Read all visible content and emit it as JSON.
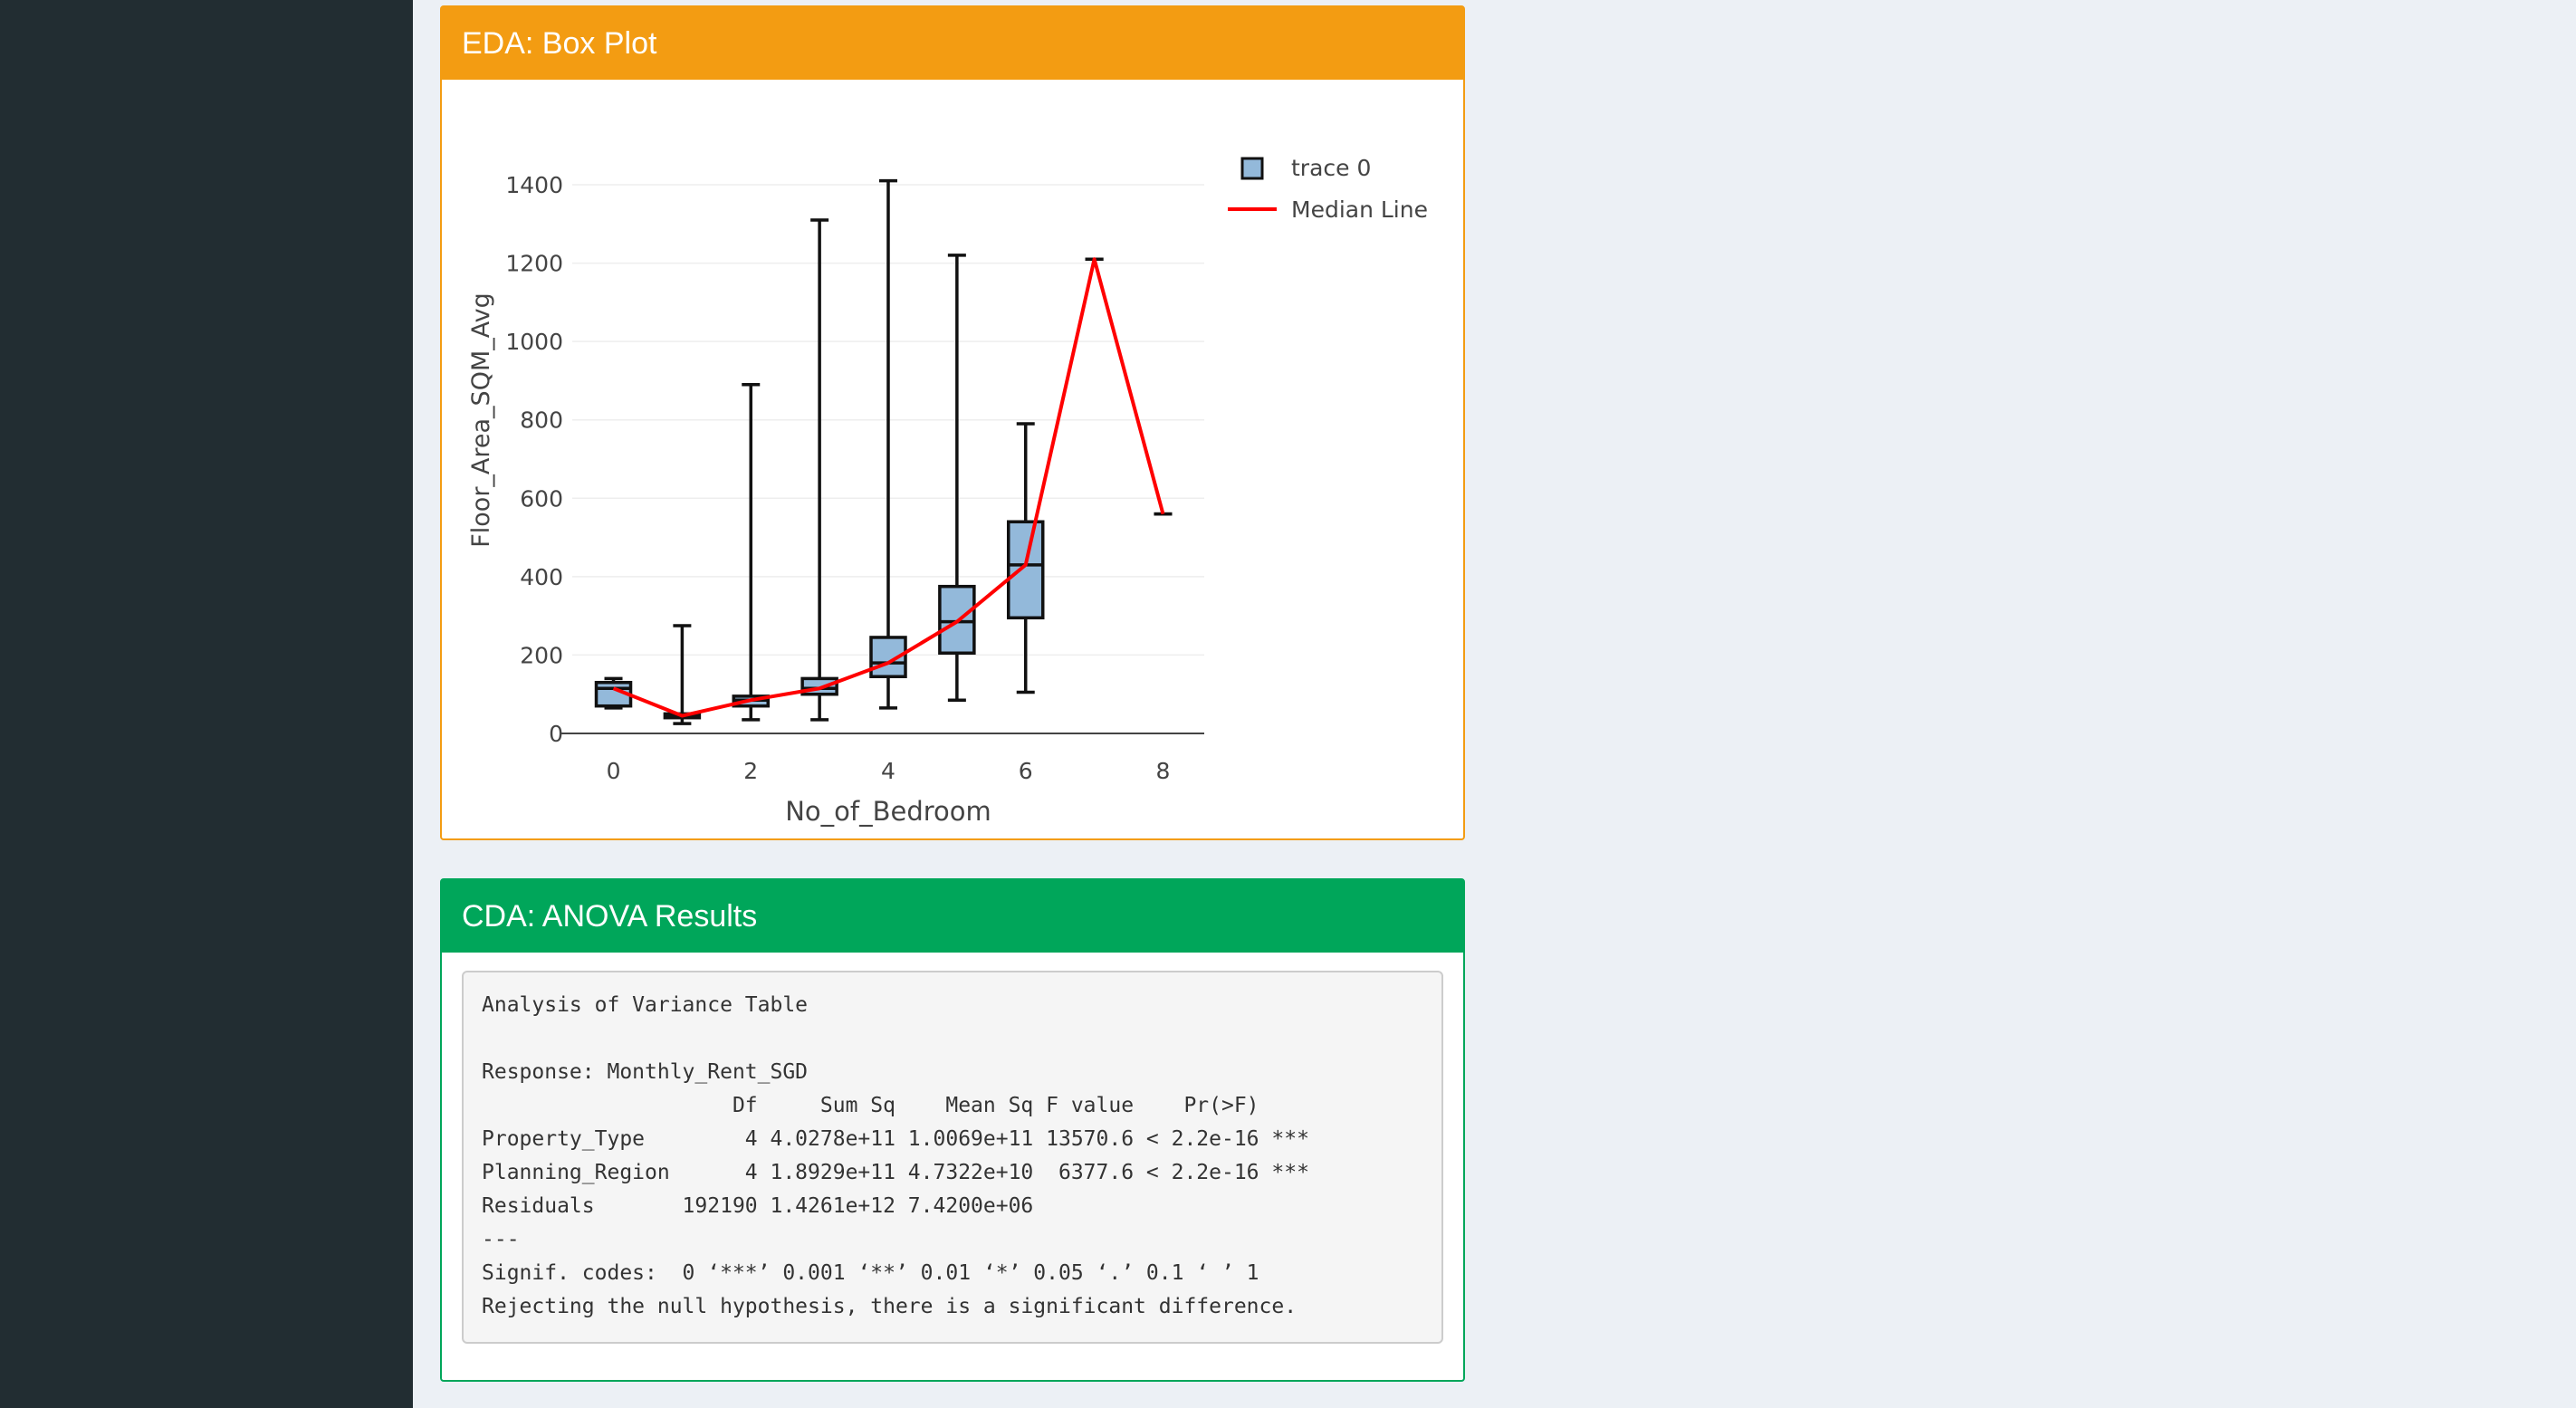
{
  "eda_box": {
    "title": "EDA: Box Plot"
  },
  "cda_box": {
    "title": "CDA: ANOVA Results"
  },
  "chart_data": {
    "type": "box",
    "xlabel": "No_of_Bedroom",
    "ylabel": "Floor_Area_SQM_Avg",
    "xlim": [
      -0.6,
      8.6
    ],
    "ylim": [
      0,
      1400
    ],
    "x_ticks": [
      0,
      2,
      4,
      6,
      8
    ],
    "y_ticks": [
      0,
      200,
      400,
      600,
      800,
      1000,
      1200,
      1400
    ],
    "grid": true,
    "legend_position": "top-right",
    "box_fill": "#93b9da",
    "box_stroke": "#111111",
    "line_color": "#ff0000",
    "series": [
      {
        "name": "trace 0",
        "kind": "box",
        "boxes": [
          {
            "x": 0,
            "min": 65,
            "q1": 70,
            "median": 115,
            "q3": 130,
            "max": 140
          },
          {
            "x": 1,
            "min": 25,
            "q1": 40,
            "median": 45,
            "q3": 50,
            "max": 275
          },
          {
            "x": 2,
            "min": 35,
            "q1": 70,
            "median": 85,
            "q3": 95,
            "max": 890
          },
          {
            "x": 3,
            "min": 35,
            "q1": 100,
            "median": 115,
            "q3": 140,
            "max": 1310
          },
          {
            "x": 4,
            "min": 65,
            "q1": 145,
            "median": 180,
            "q3": 245,
            "max": 1410
          },
          {
            "x": 5,
            "min": 85,
            "q1": 205,
            "median": 285,
            "q3": 375,
            "max": 1220
          },
          {
            "x": 6,
            "min": 105,
            "q1": 295,
            "median": 430,
            "q3": 540,
            "max": 790
          },
          {
            "x": 7,
            "min": 1210,
            "q1": 1210,
            "median": 1210,
            "q3": 1210,
            "max": 1210
          },
          {
            "x": 8,
            "min": 560,
            "q1": 560,
            "median": 560,
            "q3": 560,
            "max": 560
          }
        ]
      },
      {
        "name": "Median Line",
        "kind": "line",
        "x": [
          0,
          1,
          2,
          3,
          4,
          5,
          6,
          7,
          8
        ],
        "values": [
          115,
          45,
          85,
          115,
          180,
          285,
          430,
          1210,
          560
        ]
      }
    ]
  },
  "anova_output": {
    "lines": [
      "Analysis of Variance Table",
      "",
      "Response: Monthly_Rent_SGD",
      "                    Df     Sum Sq    Mean Sq F value    Pr(>F)    ",
      "Property_Type        4 4.0278e+11 1.0069e+11 13570.6 < 2.2e-16 ***",
      "Planning_Region      4 1.8929e+11 4.7322e+10  6377.6 < 2.2e-16 ***",
      "Residuals       192190 1.4261e+12 7.4200e+06                      ",
      "---",
      "Signif. codes:  0 ‘***’ 0.001 ‘**’ 0.01 ‘*’ 0.05 ‘.’ 0.1 ‘ ’ 1",
      "Rejecting the null hypothesis, there is a significant difference."
    ]
  }
}
